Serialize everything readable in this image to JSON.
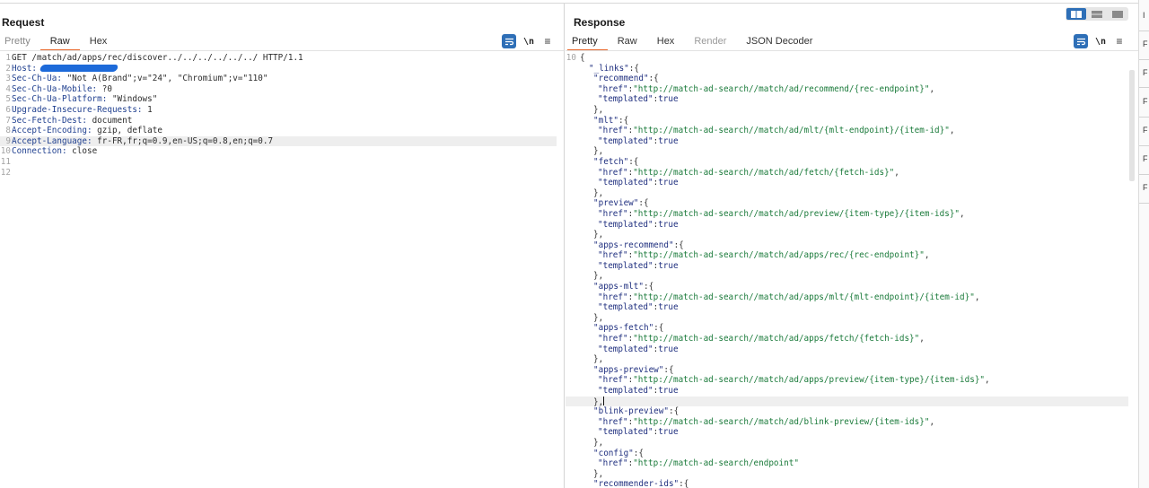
{
  "request": {
    "title": "Request",
    "tabs": [
      "Pretty",
      "Raw",
      "Hex"
    ],
    "active_tab": "Raw",
    "toolbar": {
      "newline_label": "\\n"
    },
    "lines": [
      {
        "n": "1",
        "text": "GET /match/ad/apps/rec/discover../../../../../../ HTTP/1.1"
      },
      {
        "n": "2",
        "name": "Host:",
        "value": "",
        "redacted": true
      },
      {
        "n": "3",
        "name": "Sec-Ch-Ua:",
        "value": " \"Not A(Brand\";v=\"24\", \"Chromium\";v=\"110\""
      },
      {
        "n": "4",
        "name": "Sec-Ch-Ua-Mobile:",
        "value": " ?0"
      },
      {
        "n": "5",
        "name": "Sec-Ch-Ua-Platform:",
        "value": " \"Windows\""
      },
      {
        "n": "6",
        "name": "Upgrade-Insecure-Requests:",
        "value": " 1"
      },
      {
        "n": "7",
        "name": "Sec-Fetch-Dest:",
        "value": " document"
      },
      {
        "n": "8",
        "name": "Accept-Encoding:",
        "value": " gzip, deflate"
      },
      {
        "n": "9",
        "name": "Accept-Language:",
        "value": " fr-FR,fr;q=0.9,en-US;q=0.8,en;q=0.7",
        "highlight": true
      },
      {
        "n": "10",
        "name": "Connection:",
        "value": " close"
      },
      {
        "n": "11",
        "text": ""
      },
      {
        "n": "12",
        "text": ""
      }
    ]
  },
  "response": {
    "title": "Response",
    "tabs": [
      "Pretty",
      "Raw",
      "Hex",
      "Render",
      "JSON Decoder"
    ],
    "active_tab": "Pretty",
    "toolbar": {
      "newline_label": "\\n"
    },
    "first_line_number": "10",
    "lines": [
      {
        "n": "10",
        "text": "{"
      },
      {
        "n": "",
        "key": "\"_links\"",
        "text": ":{",
        "indent": 2
      },
      {
        "n": "",
        "key": "\"recommend\"",
        "text": ":{",
        "indent": 3
      },
      {
        "n": "",
        "key": "\"href\"",
        "str": "\"http://match-ad-search//match/ad/recommend/{rec-endpoint}\"",
        "text": ",",
        "indent": 4
      },
      {
        "n": "",
        "key": "\"templated\"",
        "lit": "true",
        "indent": 4
      },
      {
        "n": "",
        "text": "},",
        "indent": 3
      },
      {
        "n": "",
        "key": "\"mlt\"",
        "text": ":{",
        "indent": 3
      },
      {
        "n": "",
        "key": "\"href\"",
        "str": "\"http://match-ad-search//match/ad/mlt/{mlt-endpoint}/{item-id}\"",
        "text": ",",
        "indent": 4
      },
      {
        "n": "",
        "key": "\"templated\"",
        "lit": "true",
        "indent": 4
      },
      {
        "n": "",
        "text": "},",
        "indent": 3
      },
      {
        "n": "",
        "key": "\"fetch\"",
        "text": ":{",
        "indent": 3
      },
      {
        "n": "",
        "key": "\"href\"",
        "str": "\"http://match-ad-search//match/ad/fetch/{fetch-ids}\"",
        "text": ",",
        "indent": 4
      },
      {
        "n": "",
        "key": "\"templated\"",
        "lit": "true",
        "indent": 4
      },
      {
        "n": "",
        "text": "},",
        "indent": 3
      },
      {
        "n": "",
        "key": "\"preview\"",
        "text": ":{",
        "indent": 3
      },
      {
        "n": "",
        "key": "\"href\"",
        "str": "\"http://match-ad-search//match/ad/preview/{item-type}/{item-ids}\"",
        "text": ",",
        "indent": 4
      },
      {
        "n": "",
        "key": "\"templated\"",
        "lit": "true",
        "indent": 4
      },
      {
        "n": "",
        "text": "},",
        "indent": 3
      },
      {
        "n": "",
        "key": "\"apps-recommend\"",
        "text": ":{",
        "indent": 3
      },
      {
        "n": "",
        "key": "\"href\"",
        "str": "\"http://match-ad-search//match/ad/apps/rec/{rec-endpoint}\"",
        "text": ",",
        "indent": 4
      },
      {
        "n": "",
        "key": "\"templated\"",
        "lit": "true",
        "indent": 4
      },
      {
        "n": "",
        "text": "},",
        "indent": 3
      },
      {
        "n": "",
        "key": "\"apps-mlt\"",
        "text": ":{",
        "indent": 3
      },
      {
        "n": "",
        "key": "\"href\"",
        "str": "\"http://match-ad-search//match/ad/apps/mlt/{mlt-endpoint}/{item-id}\"",
        "text": ",",
        "indent": 4
      },
      {
        "n": "",
        "key": "\"templated\"",
        "lit": "true",
        "indent": 4
      },
      {
        "n": "",
        "text": "},",
        "indent": 3
      },
      {
        "n": "",
        "key": "\"apps-fetch\"",
        "text": ":{",
        "indent": 3
      },
      {
        "n": "",
        "key": "\"href\"",
        "str": "\"http://match-ad-search//match/ad/apps/fetch/{fetch-ids}\"",
        "text": ",",
        "indent": 4
      },
      {
        "n": "",
        "key": "\"templated\"",
        "lit": "true",
        "indent": 4
      },
      {
        "n": "",
        "text": "},",
        "indent": 3
      },
      {
        "n": "",
        "key": "\"apps-preview\"",
        "text": ":{",
        "indent": 3
      },
      {
        "n": "",
        "key": "\"href\"",
        "str": "\"http://match-ad-search//match/ad/apps/preview/{item-type}/{item-ids}\"",
        "text": ",",
        "indent": 4
      },
      {
        "n": "",
        "key": "\"templated\"",
        "lit": "true",
        "indent": 4
      },
      {
        "n": "",
        "text": "},",
        "indent": 3,
        "highlight": true,
        "cursor": true
      },
      {
        "n": "",
        "key": "\"blink-preview\"",
        "text": ":{",
        "indent": 3
      },
      {
        "n": "",
        "key": "\"href\"",
        "str": "\"http://match-ad-search//match/ad/blink-preview/{item-ids}\"",
        "text": ",",
        "indent": 4
      },
      {
        "n": "",
        "key": "\"templated\"",
        "lit": "true",
        "indent": 4
      },
      {
        "n": "",
        "text": "},",
        "indent": 3
      },
      {
        "n": "",
        "key": "\"config\"",
        "text": ":{",
        "indent": 3
      },
      {
        "n": "",
        "key": "\"href\"",
        "str": "\"http://match-ad-search/endpoint\"",
        "indent": 4
      },
      {
        "n": "",
        "text": "},",
        "indent": 3
      },
      {
        "n": "",
        "key": "\"recommender-ids\"",
        "text": ":{",
        "indent": 3
      }
    ]
  },
  "edge_items": [
    "I",
    "F",
    "F",
    "F",
    "F",
    "F",
    "F"
  ],
  "colors": {
    "accent": "#e8672b",
    "button_blue": "#2e6fb7",
    "json_string": "#1a7a3a",
    "json_key": "#1f2f7f",
    "redaction": "#1d6ad9"
  }
}
